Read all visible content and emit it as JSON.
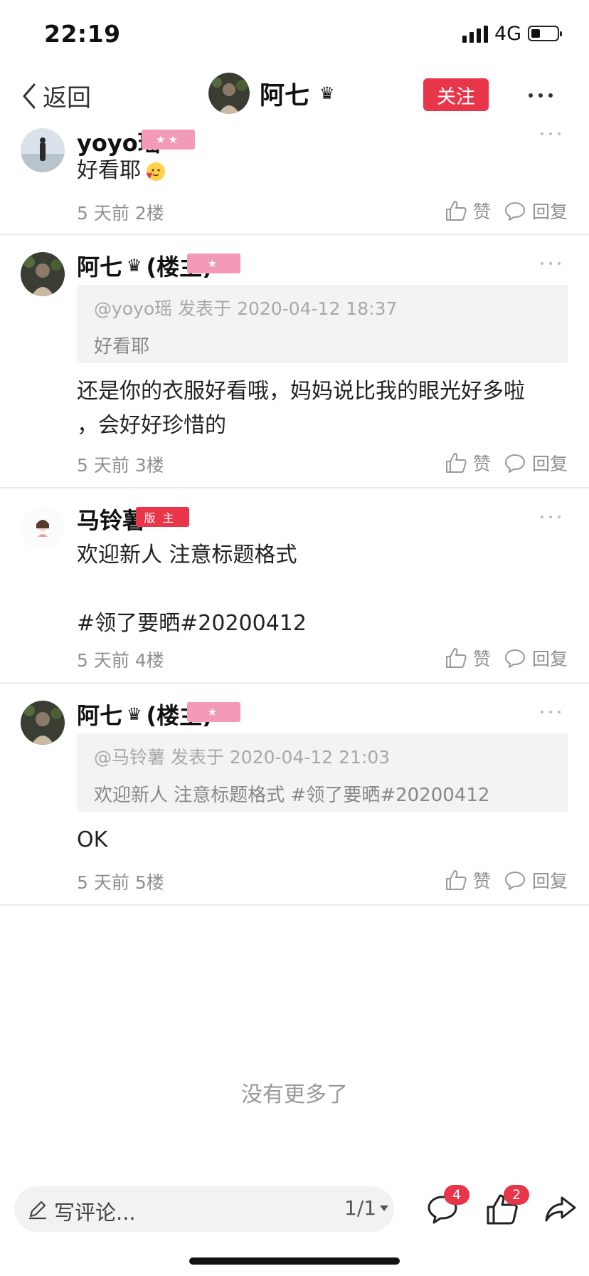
{
  "status_bar": {
    "time": "22:19",
    "network": "4G"
  },
  "nav": {
    "back_label": "返回",
    "host_name": "阿七",
    "follow_label": "关注"
  },
  "comments": [
    {
      "name": "yoyo瑶",
      "badge_stars": "★★",
      "text": "好看耶",
      "time": "5 天前",
      "floor": "2楼"
    },
    {
      "name": "阿七",
      "host_tag": "(楼主)",
      "badge_stars": "★",
      "quote_meta": "@yoyo瑶 发表于 2020-04-12 18:37",
      "quote_text": "好看耶",
      "text": "还是你的衣服好看哦，妈妈说比我的眼光好多啦\n，会好好珍惜的",
      "time": "5 天前",
      "floor": "3楼"
    },
    {
      "name": "马铃薯",
      "badge_role": "版主",
      "text": "欢迎新人 注意标题格式\n\n#领了要晒#20200412",
      "time": "5 天前",
      "floor": "4楼"
    },
    {
      "name": "阿七",
      "host_tag": "(楼主)",
      "badge_stars": "★",
      "quote_meta": "@马铃薯 发表于 2020-04-12 21:03",
      "quote_text": "欢迎新人 注意标题格式 #领了要晒#20200412",
      "text": "OK",
      "time": "5 天前",
      "floor": "5楼"
    }
  ],
  "actions": {
    "like_label": "赞",
    "reply_label": "回复"
  },
  "footer": {
    "no_more": "没有更多了"
  },
  "bottom_bar": {
    "placeholder": "写评论...",
    "page": "1/1",
    "comment_count": "4",
    "like_count": "2"
  },
  "colors": {
    "accent": "#e8354a",
    "badge_pink": "#f29ab6",
    "quote_bg": "#f3f3f3"
  }
}
